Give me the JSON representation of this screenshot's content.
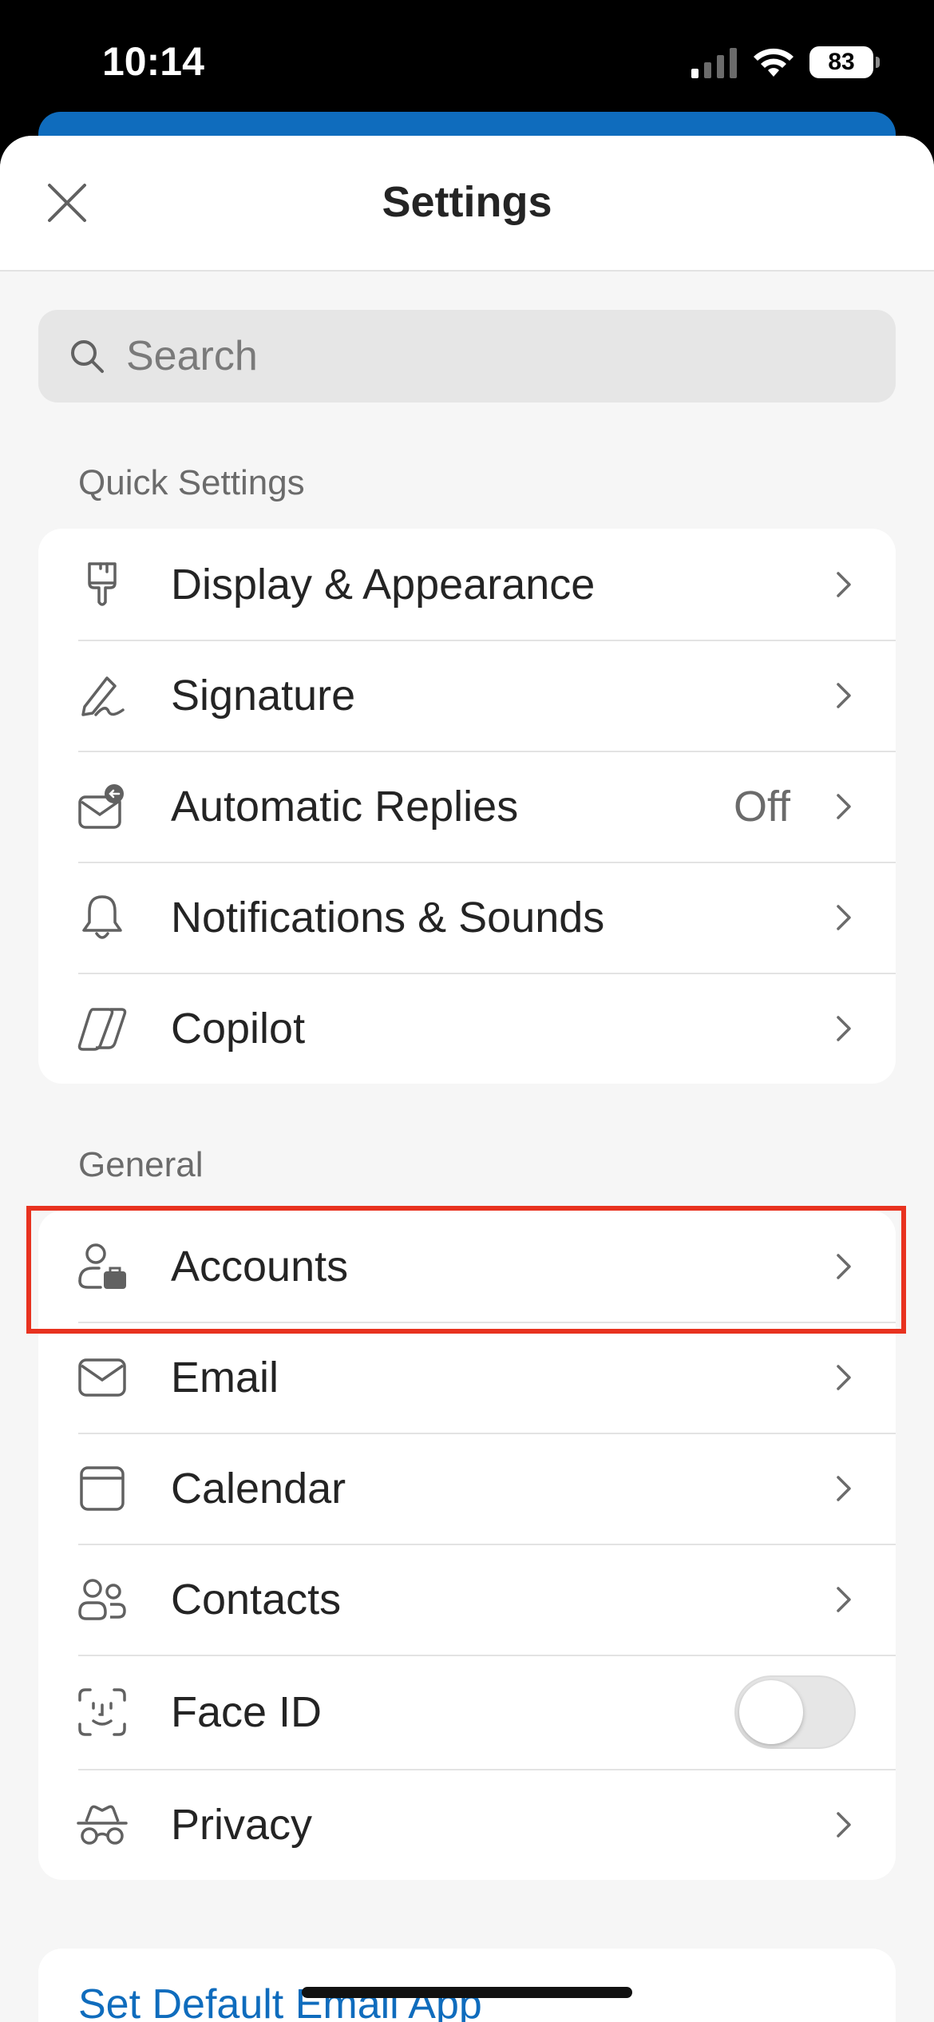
{
  "status_bar": {
    "time": "10:14",
    "battery": "83",
    "signal_icon": "cellular-signal-icon",
    "wifi_icon": "wifi-icon"
  },
  "header": {
    "title": "Settings",
    "close_icon": "close-icon"
  },
  "search": {
    "placeholder": "Search",
    "icon": "search-icon"
  },
  "quick_settings": {
    "label": "Quick Settings",
    "items": [
      {
        "label": "Display & Appearance",
        "icon": "paintbrush-icon"
      },
      {
        "label": "Signature",
        "icon": "pen-signature-icon"
      },
      {
        "label": "Automatic Replies",
        "value": "Off",
        "icon": "mail-reply-icon"
      },
      {
        "label": "Notifications & Sounds",
        "icon": "bell-icon"
      },
      {
        "label": "Copilot",
        "icon": "copilot-icon"
      }
    ]
  },
  "general": {
    "label": "General",
    "items": [
      {
        "label": "Accounts",
        "icon": "person-briefcase-icon"
      },
      {
        "label": "Email",
        "icon": "envelope-icon"
      },
      {
        "label": "Calendar",
        "icon": "calendar-icon"
      },
      {
        "label": "Contacts",
        "icon": "people-icon"
      },
      {
        "label": "Face ID",
        "icon": "face-id-icon",
        "toggle_on": false
      },
      {
        "label": "Privacy",
        "icon": "incognito-icon"
      }
    ]
  },
  "footer": {
    "link": "Set Default Email App"
  },
  "colors": {
    "accent": "#0f6cbd",
    "highlight": "#e8321f",
    "background": "#f6f6f6"
  }
}
